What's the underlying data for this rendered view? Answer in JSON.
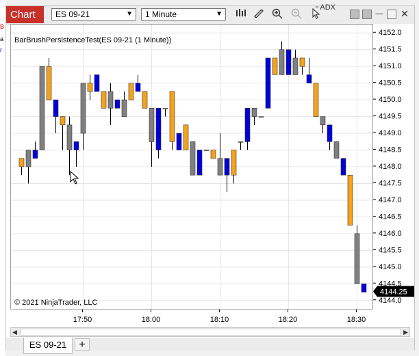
{
  "toolbar": {
    "chart_label": "Chart",
    "instrument": "ES 09-21",
    "interval": "1 Minute",
    "background_indicator": "ADX",
    "icons": [
      "bar-chart-icon",
      "draw-tool-icon",
      "zoom-in-icon",
      "zoom-out-icon",
      "pointer-icon"
    ]
  },
  "chart_title": "BarBrushPersistenceTest(ES 09-21 (1 Minute))",
  "copyright": "© 2021 NinjaTrader, LLC",
  "last_price_label": "4144.25",
  "tabs": [
    {
      "label": "ES 09-21"
    }
  ],
  "add_tab_label": "+",
  "colors": {
    "up": "#f5a21b",
    "down": "#0000d8",
    "neutral": "#808080",
    "price_marker": "#000000"
  },
  "chart_data": {
    "type": "candlestick",
    "y_ticks": [
      4144.0,
      4144.5,
      4145.0,
      4145.5,
      4146.0,
      4146.5,
      4147.0,
      4147.5,
      4148.0,
      4148.5,
      4149.0,
      4149.5,
      4150.0,
      4150.5,
      4151.0,
      4151.5,
      4152.0
    ],
    "y_tick_labels": [
      "4144.0",
      "4144.5",
      "4145.0",
      "4145.5",
      "4146.0",
      "4146.5",
      "4147.0",
      "4147.5",
      "4148.0",
      "4148.5",
      "4149.0",
      "4149.5",
      "4150.0",
      "4150.5",
      "4151.0",
      "4151.5",
      "4152.0"
    ],
    "ylim": [
      4143.75,
      4152.25
    ],
    "x_ticks": [
      {
        "label": "17:50",
        "index": 9
      },
      {
        "label": "18:00",
        "index": 19
      },
      {
        "label": "18:10",
        "index": 29
      },
      {
        "label": "18:20",
        "index": 39
      },
      {
        "label": "18:30",
        "index": 49
      }
    ],
    "bars": [
      {
        "o": 4148.0,
        "h": 4148.25,
        "l": 4147.75,
        "c": 4148.25,
        "color": "up"
      },
      {
        "o": 4148.0,
        "h": 4148.5,
        "l": 4147.5,
        "c": 4148.5,
        "color": "neutral"
      },
      {
        "o": 4148.5,
        "h": 4148.75,
        "l": 4148.25,
        "c": 4148.25,
        "color": "down"
      },
      {
        "o": 4148.5,
        "h": 4151.0,
        "l": 4148.5,
        "c": 4151.0,
        "color": "neutral"
      },
      {
        "o": 4151.0,
        "h": 4151.25,
        "l": 4150.0,
        "c": 4150.0,
        "color": "up"
      },
      {
        "o": 4150.0,
        "h": 4150.0,
        "l": 4149.0,
        "c": 4149.5,
        "color": "down"
      },
      {
        "o": 4149.5,
        "h": 4149.5,
        "l": 4148.5,
        "c": 4149.25,
        "color": "up"
      },
      {
        "o": 4148.5,
        "h": 4149.5,
        "l": 4147.75,
        "c": 4149.25,
        "color": "neutral"
      },
      {
        "o": 4148.75,
        "h": 4148.75,
        "l": 4148.0,
        "c": 4148.5,
        "color": "down"
      },
      {
        "o": 4149.0,
        "h": 4150.5,
        "l": 4148.5,
        "c": 4150.5,
        "color": "neutral"
      },
      {
        "o": 4150.5,
        "h": 4150.75,
        "l": 4150.0,
        "c": 4150.25,
        "color": "up"
      },
      {
        "o": 4150.75,
        "h": 4150.75,
        "l": 4150.25,
        "c": 4150.25,
        "color": "down"
      },
      {
        "o": 4150.25,
        "h": 4150.25,
        "l": 4149.75,
        "c": 4149.75,
        "color": "up"
      },
      {
        "o": 4150.25,
        "h": 4150.5,
        "l": 4149.25,
        "c": 4149.75,
        "color": "neutral"
      },
      {
        "o": 4150.0,
        "h": 4150.0,
        "l": 4149.75,
        "c": 4149.75,
        "color": "down"
      },
      {
        "o": 4149.5,
        "h": 4150.25,
        "l": 4149.5,
        "c": 4150.0,
        "color": "neutral"
      },
      {
        "o": 4150.0,
        "h": 4150.5,
        "l": 4150.0,
        "c": 4150.5,
        "color": "up"
      },
      {
        "o": 4150.25,
        "h": 4150.75,
        "l": 4150.25,
        "c": 4150.5,
        "color": "down"
      },
      {
        "o": 4150.25,
        "h": 4150.25,
        "l": 4149.75,
        "c": 4149.75,
        "color": "up"
      },
      {
        "o": 4149.75,
        "h": 4149.75,
        "l": 4148.0,
        "c": 4148.75,
        "color": "neutral"
      },
      {
        "o": 4149.75,
        "h": 4149.75,
        "l": 4148.25,
        "c": 4148.5,
        "color": "down"
      },
      {
        "o": 4149.75,
        "h": 4149.75,
        "l": 4149.5,
        "c": 4149.75,
        "color": "up"
      },
      {
        "o": 4150.25,
        "h": 4150.25,
        "l": 4148.5,
        "c": 4148.75,
        "color": "up"
      },
      {
        "o": 4149.0,
        "h": 4149.0,
        "l": 4148.5,
        "c": 4148.5,
        "color": "down"
      },
      {
        "o": 4148.5,
        "h": 4149.25,
        "l": 4148.5,
        "c": 4149.25,
        "color": "up"
      },
      {
        "o": 4148.75,
        "h": 4148.75,
        "l": 4147.75,
        "c": 4147.75,
        "color": "neutral"
      },
      {
        "o": 4148.5,
        "h": 4148.5,
        "l": 4147.75,
        "c": 4147.75,
        "color": "down"
      },
      {
        "o": 4148.5,
        "h": 4148.5,
        "l": 4148.5,
        "c": 4148.5,
        "color": "neutral"
      },
      {
        "o": 4148.25,
        "h": 4148.5,
        "l": 4148.25,
        "c": 4148.5,
        "color": "up"
      },
      {
        "o": 4148.25,
        "h": 4149.0,
        "l": 4147.75,
        "c": 4147.75,
        "color": "neutral"
      },
      {
        "o": 4148.25,
        "h": 4148.25,
        "l": 4147.25,
        "c": 4147.75,
        "color": "down"
      },
      {
        "o": 4147.75,
        "h": 4148.5,
        "l": 4147.5,
        "c": 4148.5,
        "color": "up"
      },
      {
        "o": 4148.75,
        "h": 4148.75,
        "l": 4148.5,
        "c": 4148.75,
        "color": "neutral"
      },
      {
        "o": 4148.75,
        "h": 4149.75,
        "l": 4148.5,
        "c": 4149.75,
        "color": "down"
      },
      {
        "o": 4149.75,
        "h": 4149.75,
        "l": 4149.25,
        "c": 4149.5,
        "color": "neutral"
      },
      {
        "o": 4149.5,
        "h": 4149.5,
        "l": 4149.5,
        "c": 4149.5,
        "color": "neutral"
      },
      {
        "o": 4149.75,
        "h": 4150.0,
        "l": 4149.75,
        "c": 4151.25,
        "color": "down"
      },
      {
        "o": 4150.75,
        "h": 4151.25,
        "l": 4150.75,
        "c": 4151.25,
        "color": "up"
      },
      {
        "o": 4151.5,
        "h": 4151.75,
        "l": 4150.75,
        "c": 4150.75,
        "color": "neutral"
      },
      {
        "o": 4150.75,
        "h": 4151.5,
        "l": 4150.75,
        "c": 4151.5,
        "color": "down"
      },
      {
        "o": 4151.25,
        "h": 4151.5,
        "l": 4150.75,
        "c": 4150.75,
        "color": "neutral"
      },
      {
        "o": 4151.0,
        "h": 4151.25,
        "l": 4150.75,
        "c": 4151.25,
        "color": "up"
      },
      {
        "o": 4150.75,
        "h": 4151.25,
        "l": 4150.5,
        "c": 4150.5,
        "color": "down"
      },
      {
        "o": 4150.5,
        "h": 4150.5,
        "l": 4149.5,
        "c": 4149.5,
        "color": "up"
      },
      {
        "o": 4149.5,
        "h": 4149.5,
        "l": 4149.0,
        "c": 4149.25,
        "color": "neutral"
      },
      {
        "o": 4149.25,
        "h": 4149.25,
        "l": 4148.5,
        "c": 4148.75,
        "color": "down"
      },
      {
        "o": 4148.75,
        "h": 4148.75,
        "l": 4148.25,
        "c": 4148.25,
        "color": "neutral"
      },
      {
        "o": 4148.25,
        "h": 4148.25,
        "l": 4147.75,
        "c": 4147.75,
        "color": "down"
      },
      {
        "o": 4147.75,
        "h": 4147.75,
        "l": 4146.25,
        "c": 4146.25,
        "color": "up"
      },
      {
        "o": 4146.0,
        "h": 4146.25,
        "l": 4144.5,
        "c": 4144.5,
        "color": "neutral"
      },
      {
        "o": 4144.5,
        "h": 4144.5,
        "l": 4144.25,
        "c": 4144.25,
        "color": "down"
      }
    ]
  }
}
